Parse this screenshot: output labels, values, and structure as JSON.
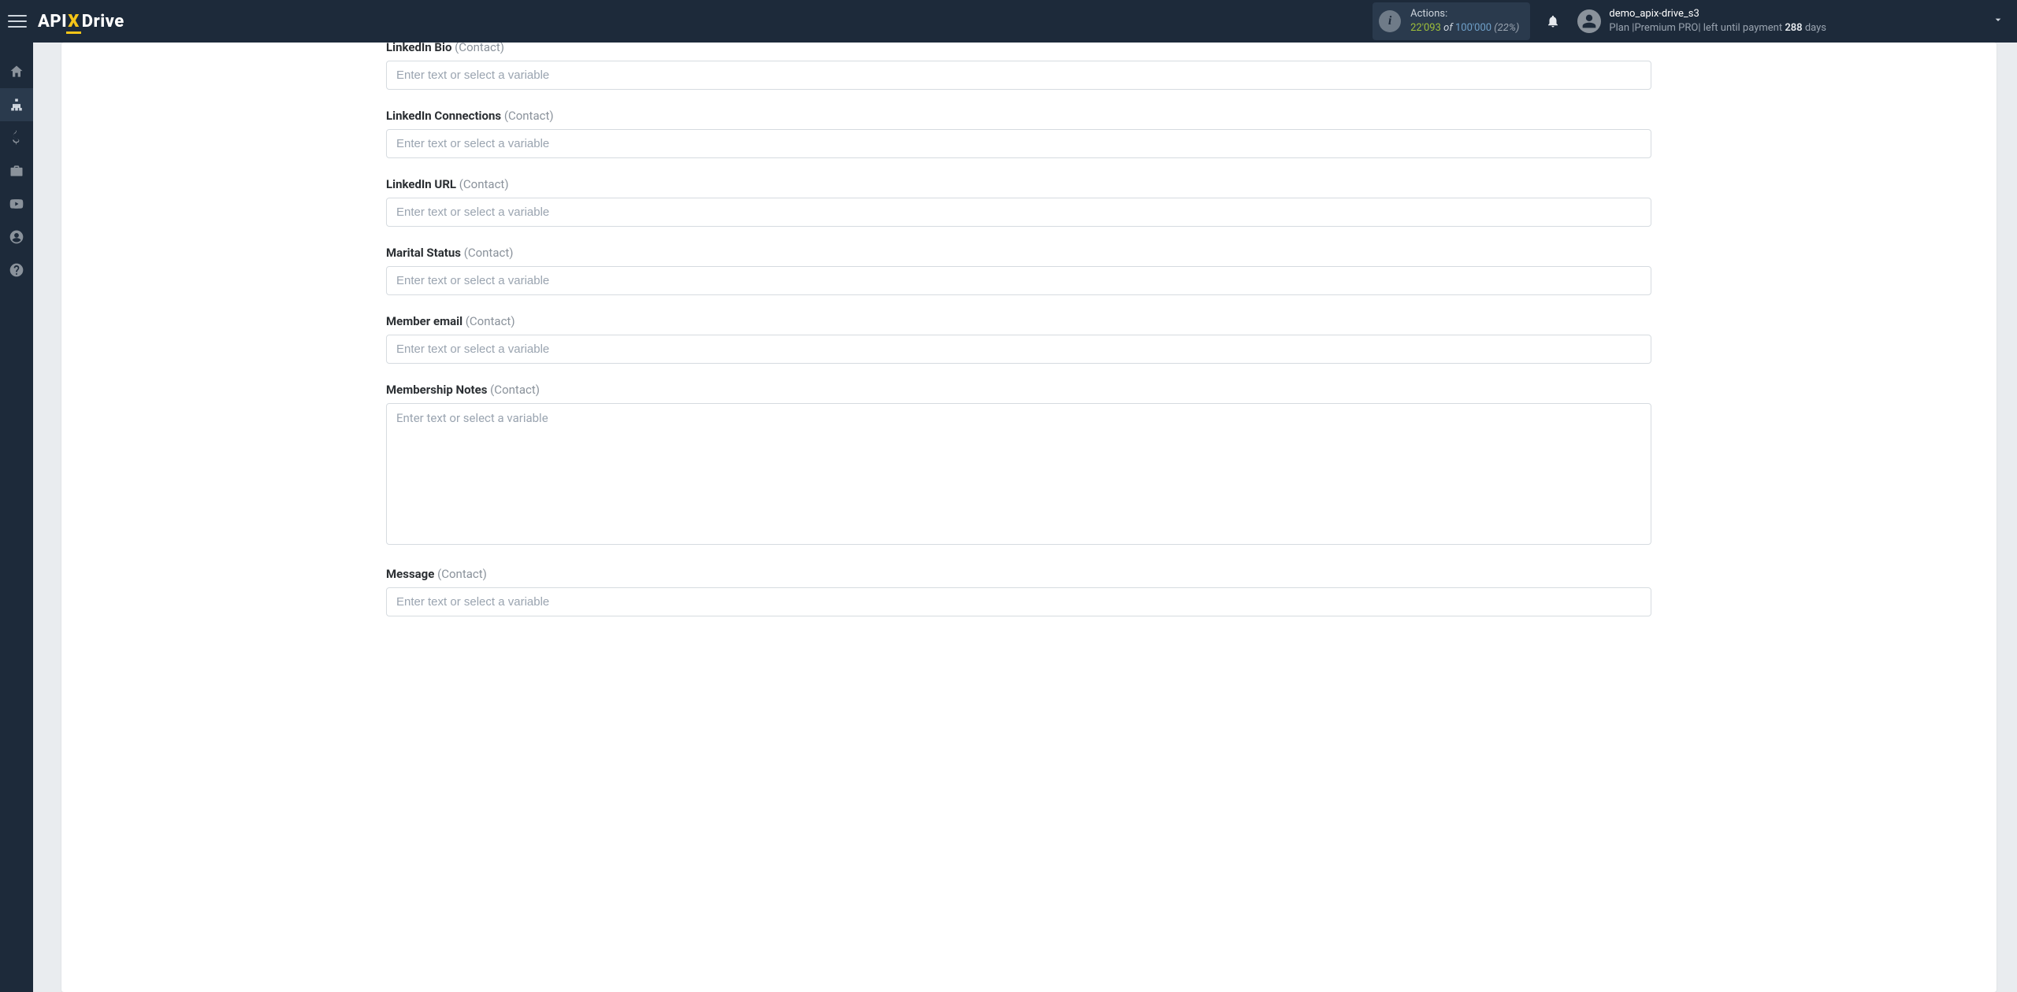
{
  "header": {
    "logo": {
      "api": "API",
      "x": "X",
      "drive": "Drive"
    },
    "actions": {
      "label": "Actions:",
      "used": "22'093",
      "of": "of",
      "total": "100'000",
      "pct": "(22%)"
    },
    "user": {
      "name": "demo_apix-drive_s3",
      "plan_prefix": "Plan |",
      "plan_name": "Premium PRO",
      "plan_mid": "| left until payment ",
      "days_left": "288",
      "days_word": " days"
    }
  },
  "sidebar": {
    "items": [
      {
        "name": "home-icon"
      },
      {
        "name": "connections-icon"
      },
      {
        "name": "billing-icon"
      },
      {
        "name": "briefcase-icon"
      },
      {
        "name": "video-icon"
      },
      {
        "name": "account-icon"
      },
      {
        "name": "help-icon"
      }
    ]
  },
  "form": {
    "placeholder": "Enter text or select a variable",
    "scope": "(Contact)",
    "fields": [
      {
        "key": "linkedin_bio",
        "label": "LinkedIn Bio",
        "type": "text"
      },
      {
        "key": "linkedin_connections",
        "label": "LinkedIn Connections",
        "type": "text"
      },
      {
        "key": "linkedin_url",
        "label": "LinkedIn URL",
        "type": "text"
      },
      {
        "key": "marital_status",
        "label": "Marital Status",
        "type": "text"
      },
      {
        "key": "member_email",
        "label": "Member email",
        "type": "text"
      },
      {
        "key": "membership_notes",
        "label": "Membership Notes",
        "type": "textarea"
      },
      {
        "key": "message",
        "label": "Message",
        "type": "text"
      }
    ]
  }
}
